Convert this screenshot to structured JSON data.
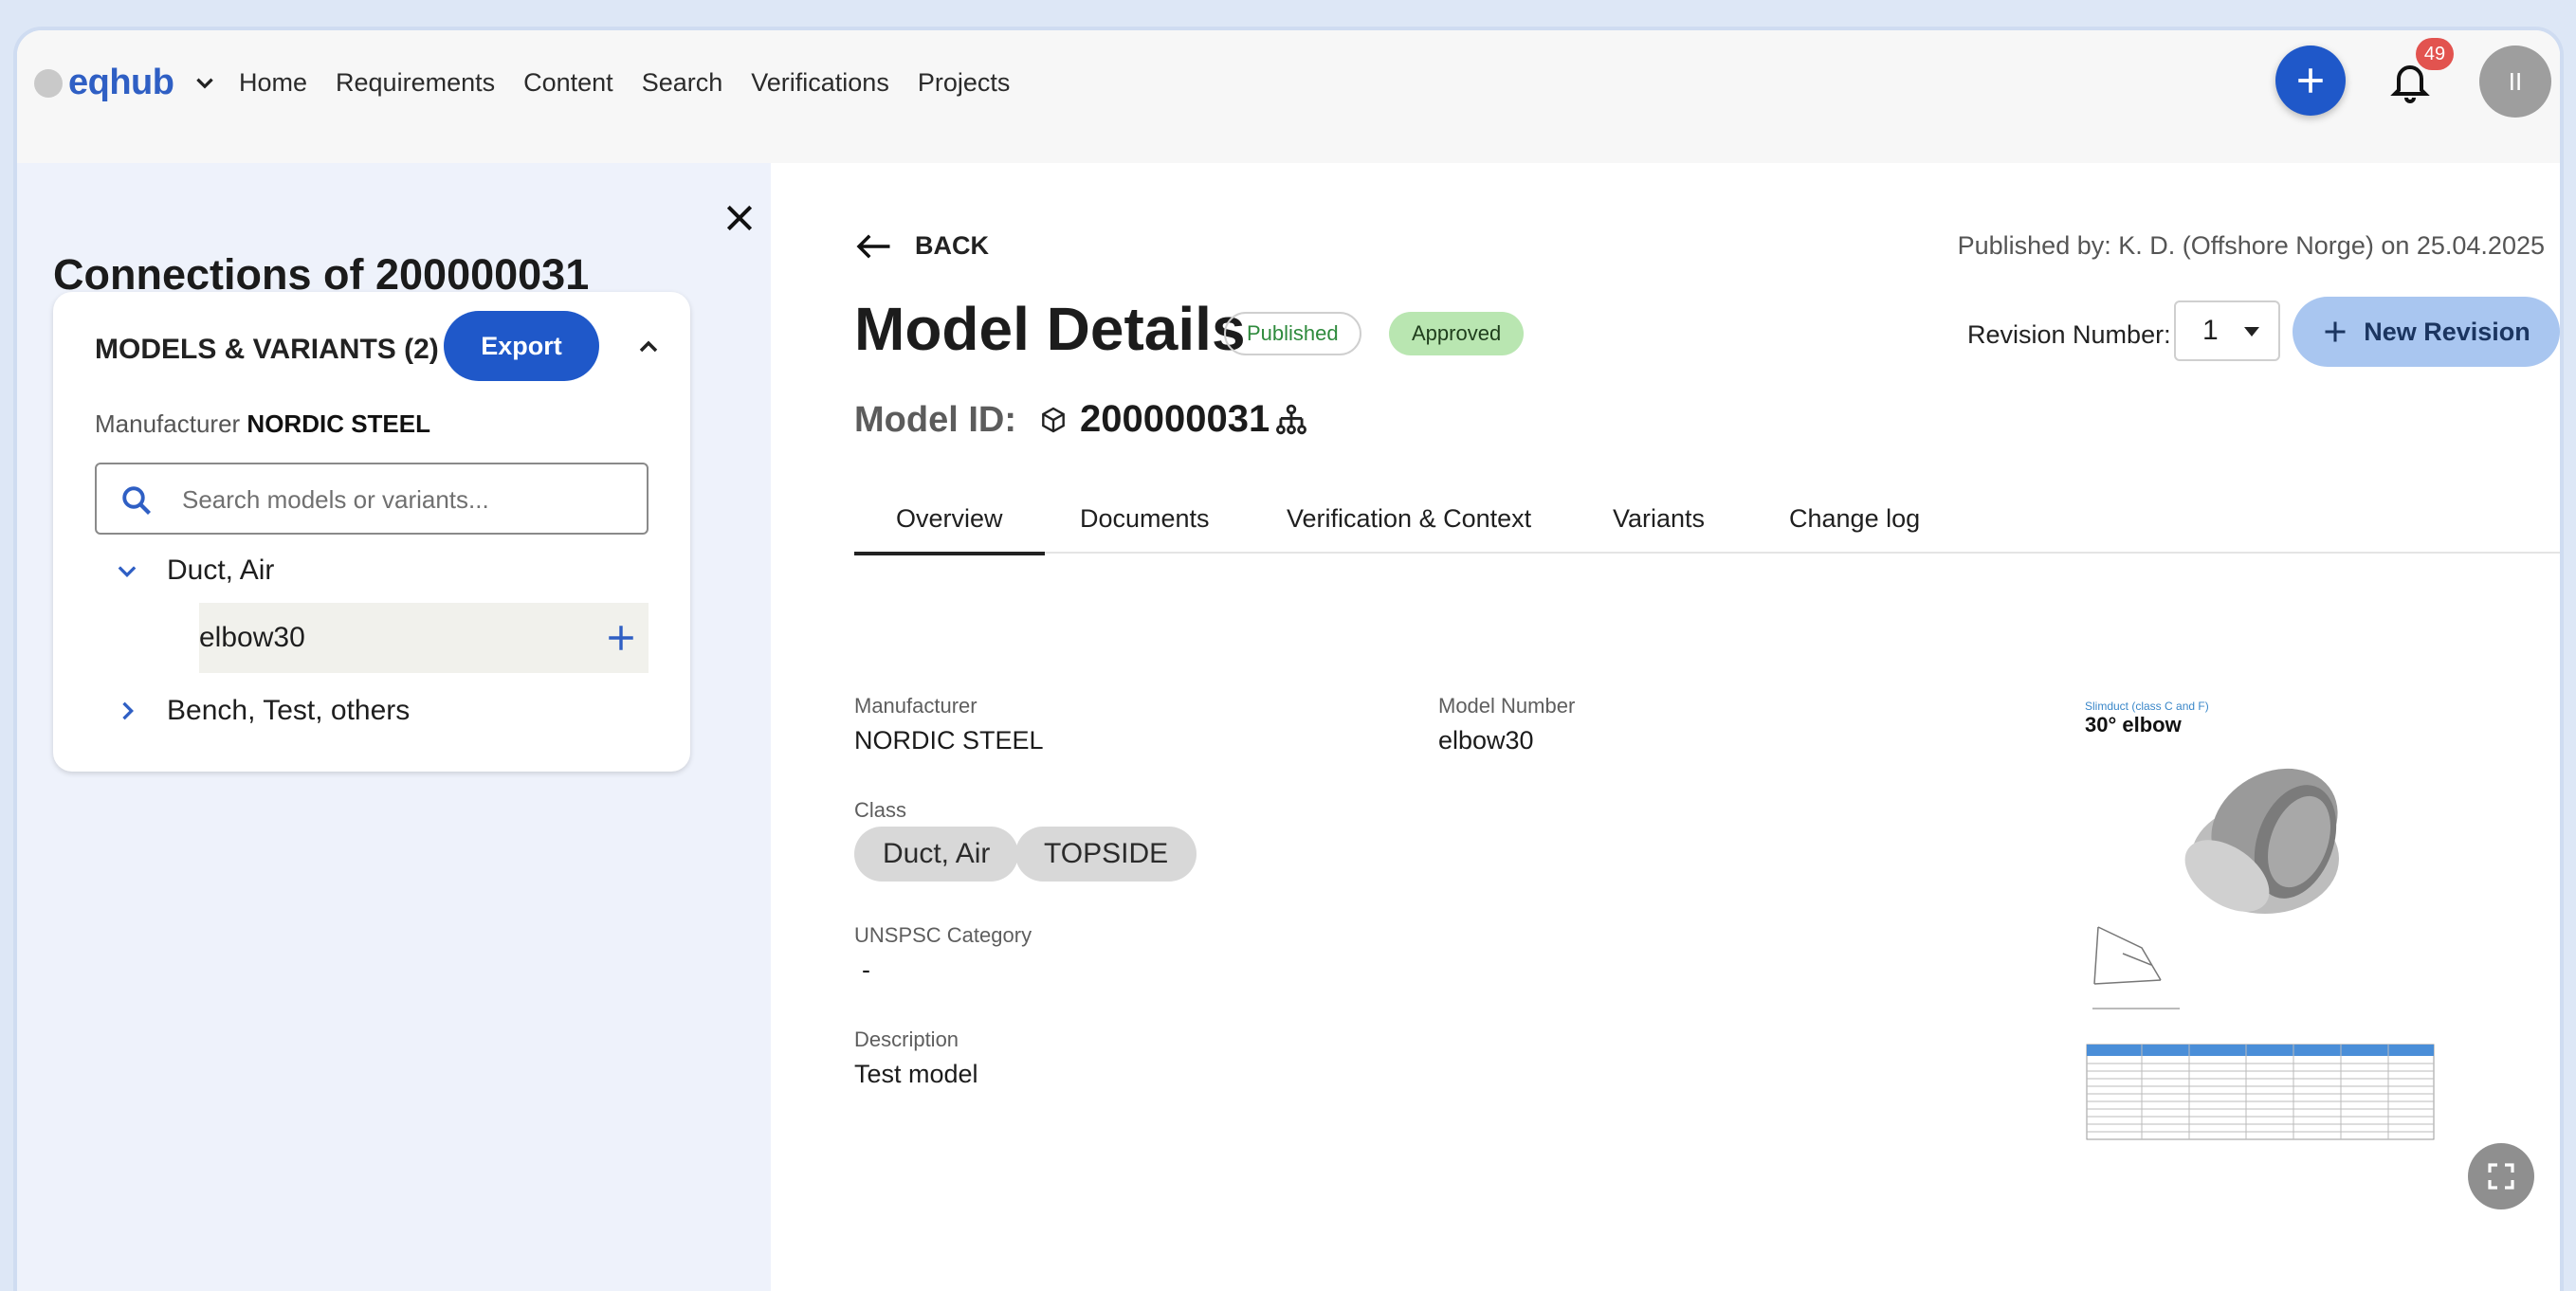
{
  "header": {
    "logo": "eqhub",
    "nav": [
      "Home",
      "Requirements",
      "Content",
      "Search",
      "Verifications",
      "Projects"
    ],
    "notification_count": "49",
    "avatar_initials": "II"
  },
  "left_panel": {
    "title": "Connections of 200000031",
    "card": {
      "header": "MODELS & VARIANTS (2)",
      "export_label": "Export",
      "manufacturer_prefix": "Manufacturer",
      "manufacturer_name": "NORDIC STEEL",
      "search_placeholder": "Search models or variants...",
      "tree": [
        {
          "label": "Duct, Air",
          "expanded": true
        },
        {
          "label": "elbow30",
          "selected": true
        },
        {
          "label": "Bench, Test, others",
          "expanded": false
        }
      ]
    }
  },
  "main": {
    "back_label": "BACK",
    "published_by": "Published by: K. D. (Offshore Norge) on 25.04.2025",
    "title": "Model Details",
    "status_published": "Published",
    "status_approved": "Approved",
    "revision_label": "Revision Number:",
    "revision_value": "1",
    "new_revision_label": "New Revision",
    "model_id_label": "Model ID:",
    "model_id_value": "200000031",
    "tabs": [
      "Overview",
      "Documents",
      "Verification & Context",
      "Variants",
      "Change log"
    ],
    "fields": {
      "manufacturer_label": "Manufacturer",
      "manufacturer_value": "NORDIC STEEL",
      "model_number_label": "Model Number",
      "model_number_value": "elbow30",
      "class_label": "Class",
      "class_values": [
        "Duct, Air",
        "TOPSIDE"
      ],
      "unspsc_label": "UNSPSC Category",
      "unspsc_value": "-",
      "description_label": "Description",
      "description_value": "Test model"
    },
    "preview": {
      "caption_small": "Slimduct (class C and F)",
      "caption_title": "30° elbow"
    }
  },
  "colors": {
    "primary": "#1f58c9",
    "badge": "#e2534f",
    "approved_bg": "#b9e6b1",
    "left_panel_bg": "#eef2fb"
  }
}
